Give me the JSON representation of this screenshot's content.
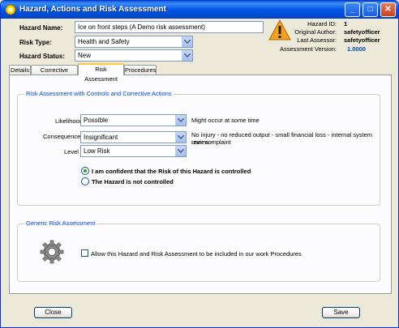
{
  "window": {
    "title": "Hazard, Actions and Risk Assessment",
    "minimize": "_",
    "maximize": "□",
    "close": "✕"
  },
  "header": {
    "hazard_name_label": "Hazard Name:",
    "hazard_name_value": "Ice on front steps (A Demo risk assessment)",
    "risk_type_label": "Risk Type:",
    "risk_type_value": "Health and Safety",
    "hazard_status_label": "Hazard Status:",
    "hazard_status_value": "New"
  },
  "info": {
    "hazard_id_label": "Hazard ID:",
    "hazard_id_value": "1",
    "original_author_label": "Original Author:",
    "original_author_value": "safetyofficer",
    "last_assessor_label": "Last Assessor:",
    "last_assessor_value": "safetyofficer",
    "assessment_version_label": "Assessment Version:",
    "assessment_version_value": "1.0000"
  },
  "tabs": [
    {
      "label": "Details"
    },
    {
      "label": "Corrective Actions"
    },
    {
      "label": "Risk Assessment"
    },
    {
      "label": "Procedures"
    }
  ],
  "risk_group": {
    "title": "Risk Assessment with Controls and Corrective Actions",
    "likelihood_label": "Likelihood",
    "likelihood_value": "Possible",
    "likelihood_desc": "Might occur at some time",
    "consequences_label": "Consequences",
    "consequences_value": "Insignificant",
    "consequences_desc_1": "No injury - no reduced output - small financial loss - internal system review -",
    "consequences_desc_2": "user complaint",
    "level_label": "Level",
    "level_value": "Low Risk",
    "radio_controlled": "I am confident that the Risk of this Hazard is controlled",
    "radio_not_controlled": "The Hazard is not controlled"
  },
  "generic_group": {
    "title": "Generic Risk Assessment",
    "include_checkbox": "Allow this Hazard and Risk Assessment to be included in our work Procedures"
  },
  "footer": {
    "close_label": "Close",
    "save_label": "Save"
  },
  "colors": {
    "title_bar": "#0058e6",
    "group_title": "#0046d5",
    "warning": "#f4a020",
    "assessment_version": "#0046d5"
  }
}
